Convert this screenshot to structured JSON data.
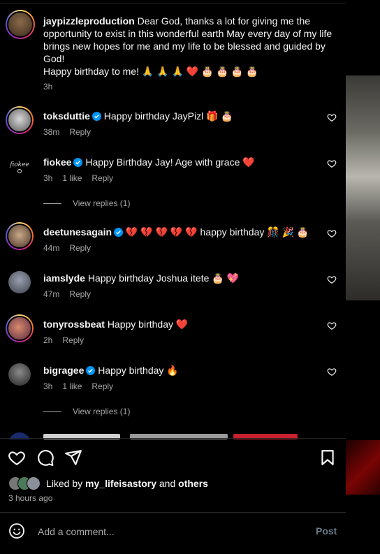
{
  "caption": {
    "username": "jaypizzleproduction",
    "text": " Dear God, thanks a lot for giving me the opportunity to exist in this wonderful earth May every day of my life brings new hopes for me and my life to be blessed and guided by God!",
    "text2": "Happy birthday to me! 🙏 🙏 🙏 ❤️ 🎂 🎂 🎂 🎂",
    "time": "3h"
  },
  "comments": [
    {
      "username": "toksduttie",
      "verified": true,
      "text": "Happy birthday JayPizl 🎁 🎂",
      "time": "38m",
      "likes": "",
      "reply": "Reply"
    },
    {
      "username": "fiokee",
      "verified": true,
      "text": "Happy Birthday Jay! Age with grace ❤️",
      "time": "3h",
      "likes": "1 like",
      "reply": "Reply"
    },
    {
      "username": "deetunesagain",
      "verified": true,
      "text": "💔 💔 💔 💔 💔  happy birthday 🎊 🎉 🎂",
      "time": "44m",
      "likes": "",
      "reply": "Reply"
    },
    {
      "username": "iamslyde",
      "verified": false,
      "text": "Happy birthday Joshua itete 🎂 💖",
      "time": "47m",
      "likes": "",
      "reply": "Reply"
    },
    {
      "username": "tonyrossbeat",
      "verified": false,
      "text": "Happy birthday ❤️",
      "time": "2h",
      "likes": "",
      "reply": "Reply"
    },
    {
      "username": "bigragee",
      "verified": true,
      "text": "Happy birthday 🔥",
      "time": "3h",
      "likes": "1 like",
      "reply": "Reply"
    }
  ],
  "view_replies": [
    "View replies (1)",
    "View replies (1)"
  ],
  "likes": {
    "prefix": "Liked by ",
    "user": "my_lifeisastory",
    "and": " and ",
    "others": "others"
  },
  "post_time": "3 hours ago",
  "add_comment": {
    "placeholder": "Add a comment...",
    "post_label": "Post"
  },
  "colors": {
    "background": "#000000",
    "text": "#f5f5f5",
    "muted": "#a8a8a8",
    "verified": "#0095f6",
    "heart_red": "#ff3040",
    "post_disabled": "#6b7b8c"
  },
  "icons": [
    "heart-icon",
    "comment-icon",
    "share-icon",
    "save-icon",
    "emoji-icon",
    "verified-icon"
  ]
}
